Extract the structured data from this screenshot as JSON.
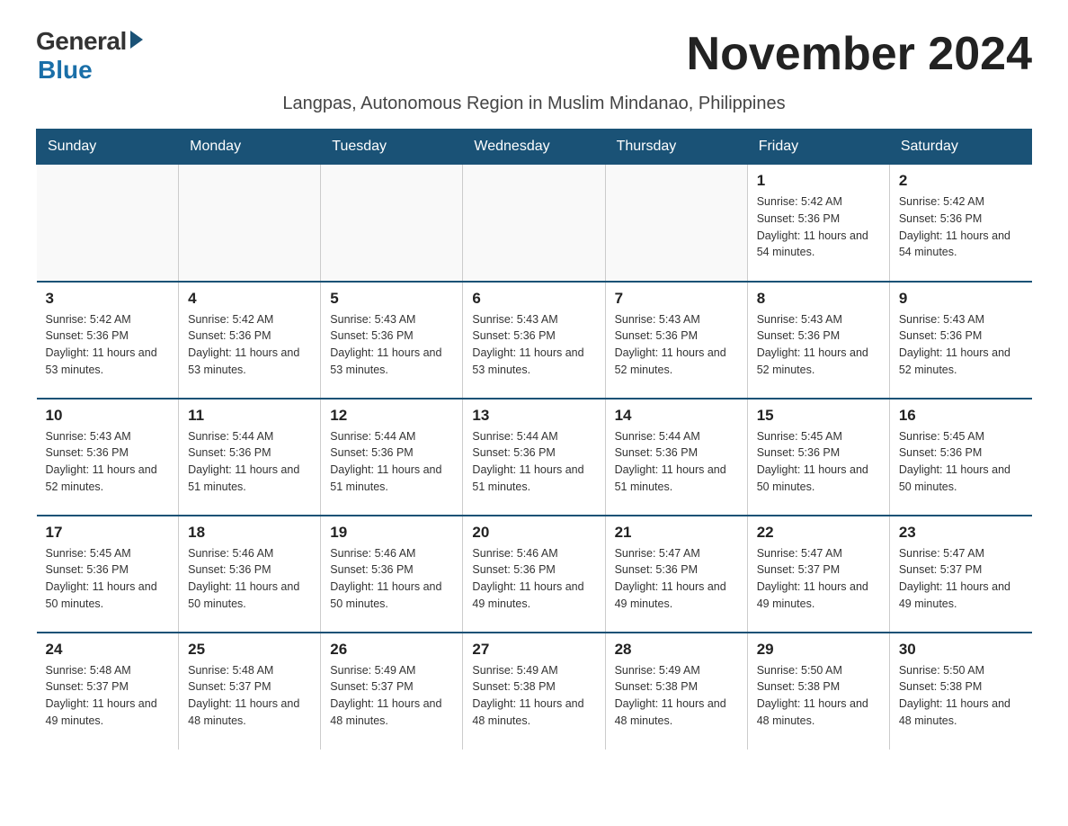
{
  "logo": {
    "general": "General",
    "blue": "Blue"
  },
  "title": "November 2024",
  "subtitle": "Langpas, Autonomous Region in Muslim Mindanao, Philippines",
  "days_of_week": [
    "Sunday",
    "Monday",
    "Tuesday",
    "Wednesday",
    "Thursday",
    "Friday",
    "Saturday"
  ],
  "weeks": [
    [
      {
        "day": "",
        "info": ""
      },
      {
        "day": "",
        "info": ""
      },
      {
        "day": "",
        "info": ""
      },
      {
        "day": "",
        "info": ""
      },
      {
        "day": "",
        "info": ""
      },
      {
        "day": "1",
        "info": "Sunrise: 5:42 AM\nSunset: 5:36 PM\nDaylight: 11 hours and 54 minutes."
      },
      {
        "day": "2",
        "info": "Sunrise: 5:42 AM\nSunset: 5:36 PM\nDaylight: 11 hours and 54 minutes."
      }
    ],
    [
      {
        "day": "3",
        "info": "Sunrise: 5:42 AM\nSunset: 5:36 PM\nDaylight: 11 hours and 53 minutes."
      },
      {
        "day": "4",
        "info": "Sunrise: 5:42 AM\nSunset: 5:36 PM\nDaylight: 11 hours and 53 minutes."
      },
      {
        "day": "5",
        "info": "Sunrise: 5:43 AM\nSunset: 5:36 PM\nDaylight: 11 hours and 53 minutes."
      },
      {
        "day": "6",
        "info": "Sunrise: 5:43 AM\nSunset: 5:36 PM\nDaylight: 11 hours and 53 minutes."
      },
      {
        "day": "7",
        "info": "Sunrise: 5:43 AM\nSunset: 5:36 PM\nDaylight: 11 hours and 52 minutes."
      },
      {
        "day": "8",
        "info": "Sunrise: 5:43 AM\nSunset: 5:36 PM\nDaylight: 11 hours and 52 minutes."
      },
      {
        "day": "9",
        "info": "Sunrise: 5:43 AM\nSunset: 5:36 PM\nDaylight: 11 hours and 52 minutes."
      }
    ],
    [
      {
        "day": "10",
        "info": "Sunrise: 5:43 AM\nSunset: 5:36 PM\nDaylight: 11 hours and 52 minutes."
      },
      {
        "day": "11",
        "info": "Sunrise: 5:44 AM\nSunset: 5:36 PM\nDaylight: 11 hours and 51 minutes."
      },
      {
        "day": "12",
        "info": "Sunrise: 5:44 AM\nSunset: 5:36 PM\nDaylight: 11 hours and 51 minutes."
      },
      {
        "day": "13",
        "info": "Sunrise: 5:44 AM\nSunset: 5:36 PM\nDaylight: 11 hours and 51 minutes."
      },
      {
        "day": "14",
        "info": "Sunrise: 5:44 AM\nSunset: 5:36 PM\nDaylight: 11 hours and 51 minutes."
      },
      {
        "day": "15",
        "info": "Sunrise: 5:45 AM\nSunset: 5:36 PM\nDaylight: 11 hours and 50 minutes."
      },
      {
        "day": "16",
        "info": "Sunrise: 5:45 AM\nSunset: 5:36 PM\nDaylight: 11 hours and 50 minutes."
      }
    ],
    [
      {
        "day": "17",
        "info": "Sunrise: 5:45 AM\nSunset: 5:36 PM\nDaylight: 11 hours and 50 minutes."
      },
      {
        "day": "18",
        "info": "Sunrise: 5:46 AM\nSunset: 5:36 PM\nDaylight: 11 hours and 50 minutes."
      },
      {
        "day": "19",
        "info": "Sunrise: 5:46 AM\nSunset: 5:36 PM\nDaylight: 11 hours and 50 minutes."
      },
      {
        "day": "20",
        "info": "Sunrise: 5:46 AM\nSunset: 5:36 PM\nDaylight: 11 hours and 49 minutes."
      },
      {
        "day": "21",
        "info": "Sunrise: 5:47 AM\nSunset: 5:36 PM\nDaylight: 11 hours and 49 minutes."
      },
      {
        "day": "22",
        "info": "Sunrise: 5:47 AM\nSunset: 5:37 PM\nDaylight: 11 hours and 49 minutes."
      },
      {
        "day": "23",
        "info": "Sunrise: 5:47 AM\nSunset: 5:37 PM\nDaylight: 11 hours and 49 minutes."
      }
    ],
    [
      {
        "day": "24",
        "info": "Sunrise: 5:48 AM\nSunset: 5:37 PM\nDaylight: 11 hours and 49 minutes."
      },
      {
        "day": "25",
        "info": "Sunrise: 5:48 AM\nSunset: 5:37 PM\nDaylight: 11 hours and 48 minutes."
      },
      {
        "day": "26",
        "info": "Sunrise: 5:49 AM\nSunset: 5:37 PM\nDaylight: 11 hours and 48 minutes."
      },
      {
        "day": "27",
        "info": "Sunrise: 5:49 AM\nSunset: 5:38 PM\nDaylight: 11 hours and 48 minutes."
      },
      {
        "day": "28",
        "info": "Sunrise: 5:49 AM\nSunset: 5:38 PM\nDaylight: 11 hours and 48 minutes."
      },
      {
        "day": "29",
        "info": "Sunrise: 5:50 AM\nSunset: 5:38 PM\nDaylight: 11 hours and 48 minutes."
      },
      {
        "day": "30",
        "info": "Sunrise: 5:50 AM\nSunset: 5:38 PM\nDaylight: 11 hours and 48 minutes."
      }
    ]
  ]
}
